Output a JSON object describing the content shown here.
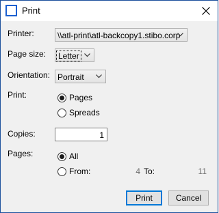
{
  "window": {
    "title": "Print"
  },
  "printer": {
    "label": "Printer:",
    "value": "\\\\atl-print\\atl-backcopy1.stibo.corp"
  },
  "page_size": {
    "label": "Page size:",
    "value": "Letter"
  },
  "orientation": {
    "label": "Orientation:",
    "value": "Portrait"
  },
  "print_mode": {
    "label": "Print:",
    "options": [
      {
        "label": "Pages",
        "checked": true
      },
      {
        "label": "Spreads",
        "checked": false
      }
    ]
  },
  "copies": {
    "label": "Copies:",
    "value": "1"
  },
  "pages": {
    "label": "Pages:",
    "all_label": "All",
    "from_label": "From:",
    "from_value": "4",
    "to_label": "To:",
    "to_value": "11"
  },
  "buttons": {
    "print": "Print",
    "cancel": "Cancel"
  },
  "icons": {
    "window_icon": "print-window-icon",
    "close": "close-icon",
    "dropdown": "chevron-down-icon"
  },
  "colors": {
    "accent": "#0078d7",
    "border": "#1a4f9c"
  }
}
